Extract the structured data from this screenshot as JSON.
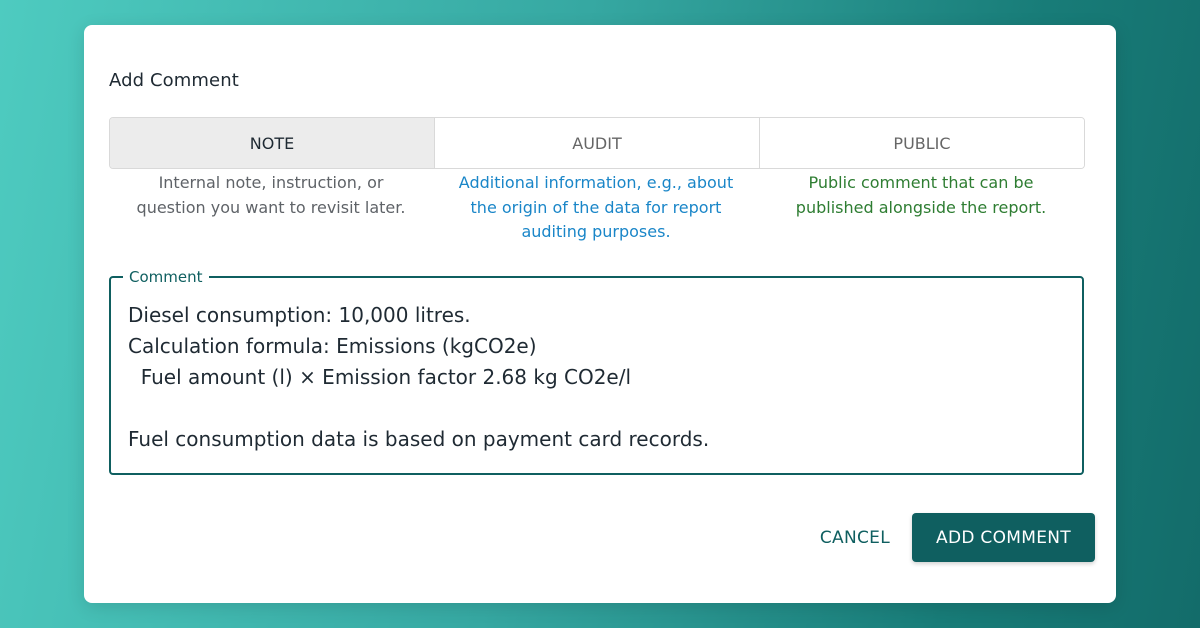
{
  "dialog": {
    "title": "Add Comment",
    "tabs": [
      {
        "label": "NOTE",
        "active": true
      },
      {
        "label": "AUDIT",
        "active": false
      },
      {
        "label": "PUBLIC",
        "active": false
      }
    ],
    "descriptions": {
      "note": [
        "Internal note, instruction, or",
        "question you want to revisit later."
      ],
      "audit": [
        "Additional information, e.g., about",
        "the origin of the data for report",
        "auditing purposes."
      ],
      "public": [
        "Public comment that can be",
        "published alongside the report."
      ]
    },
    "comment": {
      "legend": "Comment",
      "lines": [
        "Diesel consumption: 10,000 litres.",
        "Calculation formula: Emissions (kgCO2e)",
        "  Fuel amount (l) × Emission factor 2.68 kg CO2e/l",
        "",
        "Fuel consumption data is based on payment card records."
      ]
    },
    "actions": {
      "cancel_label": "CANCEL",
      "add_label": "ADD COMMENT"
    }
  },
  "colors": {
    "primary": "#0f5f60",
    "audit_text": "#1a86c8",
    "public_text": "#2e7d32",
    "note_text": "#5f6368",
    "active_tab_bg": "#ececec"
  }
}
